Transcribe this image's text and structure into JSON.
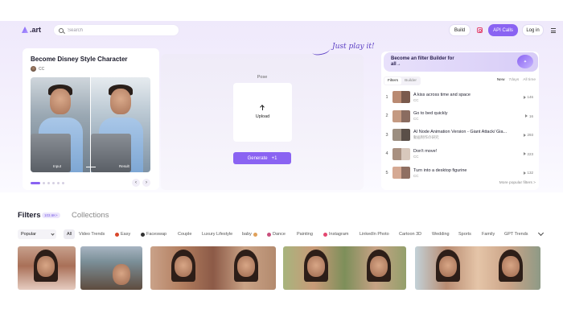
{
  "header": {
    "logo": ".art",
    "search_placeholder": "Search",
    "build_label": "Build",
    "api_label": "API Calls",
    "login_label": "Log in"
  },
  "hero": {
    "title": "Become Disney Style Character",
    "author": "CC",
    "input_label": "Input",
    "result_label": "Result",
    "pose_label": "Pose",
    "upload_label": "Upload",
    "generate_label": "Generate",
    "generate_cost": "+1",
    "play_text": "Just play it!",
    "carousel_active": 1,
    "carousel_total": 6
  },
  "builder": {
    "banner_text": "Become an filter Builder for all→",
    "tabs": [
      "Filters",
      "Builder"
    ],
    "time_filters": [
      "New",
      "7days",
      "All time"
    ],
    "items": [
      {
        "rank": "1",
        "title": "A kiss across time and space",
        "author": "CC",
        "count": "146",
        "colors": [
          "#b98a72",
          "#7a5a4c"
        ]
      },
      {
        "rank": "2",
        "title": "Go to bed quickly",
        "author": "CC",
        "count": "16",
        "colors": [
          "#c49a82",
          "#8a6c60"
        ]
      },
      {
        "rank": "3",
        "title": "AI Node Animation Version - Giant Attack/ Gia...",
        "author": "動画制作の研究",
        "count": "293",
        "colors": [
          "#9c8e80",
          "#5a4f48"
        ]
      },
      {
        "rank": "4",
        "title": "Don't move!",
        "author": "CC",
        "count": "223",
        "colors": [
          "#a89080",
          "#d8c8bc"
        ]
      },
      {
        "rank": "5",
        "title": "Turn into a desktop figurine",
        "author": "CC",
        "count": "132",
        "colors": [
          "#d5a993",
          "#8f6f62"
        ]
      }
    ],
    "more_label": "More popular filters >"
  },
  "filters_section": {
    "title": "Filters",
    "count": "103.6K+",
    "collections_label": "Collections",
    "sort_value": "Popular",
    "categories": [
      {
        "label": "All",
        "icon": ""
      },
      {
        "label": "Video Trends",
        "icon": ""
      },
      {
        "label": "Easy",
        "icon": "tomato-icon"
      },
      {
        "label": "Faceswap",
        "icon": "face-icon"
      },
      {
        "label": "Couple",
        "icon": ""
      },
      {
        "label": "Luxury Lifestyle",
        "icon": ""
      },
      {
        "label": "baby",
        "icon": "baby-icon"
      },
      {
        "label": "Dance",
        "icon": "dance-icon"
      },
      {
        "label": "Painting",
        "icon": ""
      },
      {
        "label": "Instagram",
        "icon": "instagram-icon"
      },
      {
        "label": "LinkedIn Photo",
        "icon": ""
      },
      {
        "label": "Cartoon 3D",
        "icon": ""
      },
      {
        "label": "Wedding",
        "icon": ""
      },
      {
        "label": "Sports",
        "icon": ""
      },
      {
        "label": "Family",
        "icon": ""
      },
      {
        "label": "GPT Trends",
        "icon": ""
      }
    ]
  },
  "colors": {
    "accent": "#8a63f2",
    "hero_bg": "#efe9fb"
  }
}
